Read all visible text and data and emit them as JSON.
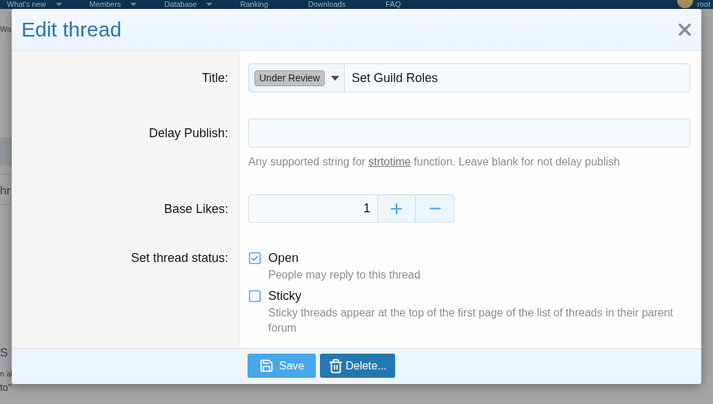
{
  "page": {
    "nav_items": [
      {
        "label": "What's new",
        "has_menu": true
      },
      {
        "label": "Members",
        "has_menu": true
      },
      {
        "label": "Database",
        "has_menu": true
      },
      {
        "label": "Ranking",
        "has_menu": false
      },
      {
        "label": "Downloads",
        "has_menu": false
      },
      {
        "label": "FAQ",
        "has_menu": false
      }
    ],
    "user": "root",
    "side_texts": [
      "Wa",
      "hr",
      "S",
      "n al",
      "to\""
    ]
  },
  "dialog": {
    "title": "Edit thread",
    "fields": [
      {
        "kind": "title",
        "label": "Title:",
        "prefix": "Under Review",
        "value": "Set Guild Roles"
      },
      {
        "kind": "text",
        "label": "Delay Publish:",
        "hint_before": "Any supported string for ",
        "hint_link": "strtotime",
        "hint_after": " function. Leave blank for not delay publish"
      },
      {
        "kind": "number",
        "label": "Base Likes:",
        "value": "1"
      },
      {
        "kind": "checkboxes",
        "label": "Set thread status:",
        "options": [
          {
            "label": "Open",
            "hint": "People may reply to this thread",
            "checked": true
          },
          {
            "label": "Sticky",
            "hint": "Sticky threads appear at the top of the first page of the list of threads in their parent forum",
            "checked": false
          }
        ]
      }
    ],
    "buttons": [
      {
        "kind": "save",
        "label": "Save"
      },
      {
        "kind": "delete",
        "label": "Delete..."
      }
    ]
  }
}
